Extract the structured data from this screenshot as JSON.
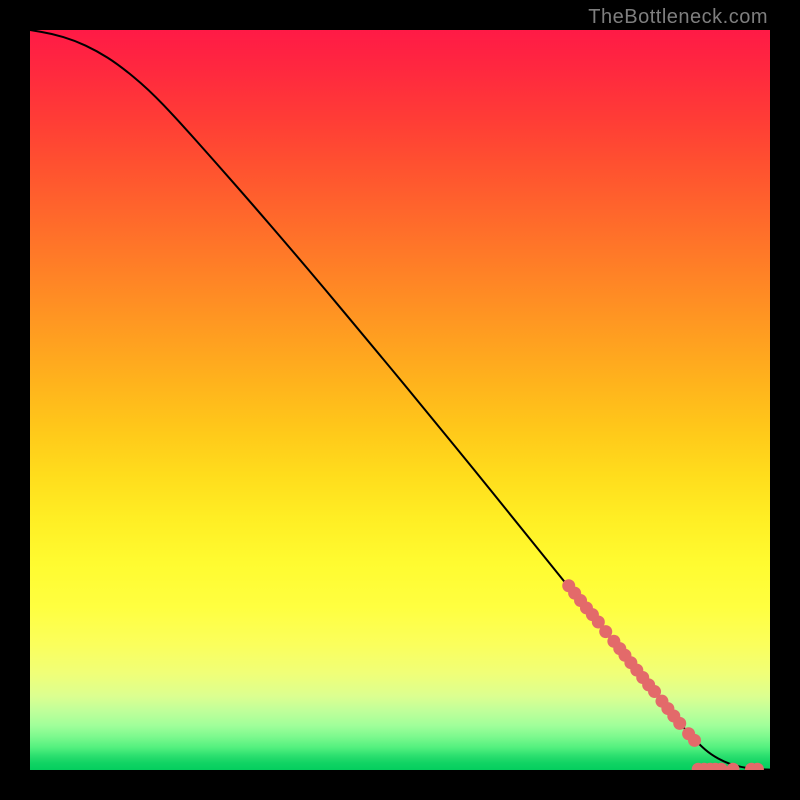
{
  "attribution": "TheBottleneck.com",
  "chart_data": {
    "type": "line",
    "title": "",
    "xlabel": "",
    "ylabel": "",
    "xlim": [
      0,
      100
    ],
    "ylim": [
      0,
      100
    ],
    "series": [
      {
        "name": "main-curve",
        "x": [
          0,
          3,
          6,
          9,
          12,
          16,
          20,
          25,
          30,
          35,
          40,
          45,
          50,
          55,
          60,
          65,
          70,
          75,
          78,
          81,
          84,
          86.5,
          88.5,
          90.5,
          92,
          94,
          96,
          98,
          100
        ],
        "y": [
          100,
          99.5,
          98.6,
          97.2,
          95.3,
          92.0,
          87.8,
          82.2,
          76.5,
          70.7,
          64.8,
          58.8,
          52.8,
          46.7,
          40.6,
          34.4,
          28.2,
          22.0,
          18.3,
          14.6,
          10.9,
          7.9,
          5.5,
          3.4,
          2.1,
          1.0,
          0.4,
          0.12,
          0.05
        ]
      }
    ],
    "markers": [
      {
        "name": "marker",
        "x": 72.8,
        "y": 24.9
      },
      {
        "name": "marker",
        "x": 73.6,
        "y": 23.9
      },
      {
        "name": "marker",
        "x": 74.4,
        "y": 22.9
      },
      {
        "name": "marker",
        "x": 75.2,
        "y": 21.9
      },
      {
        "name": "marker",
        "x": 76.0,
        "y": 21.0
      },
      {
        "name": "marker",
        "x": 76.8,
        "y": 20.0
      },
      {
        "name": "marker",
        "x": 77.8,
        "y": 18.7
      },
      {
        "name": "marker",
        "x": 78.9,
        "y": 17.4
      },
      {
        "name": "marker",
        "x": 79.7,
        "y": 16.4
      },
      {
        "name": "marker",
        "x": 80.4,
        "y": 15.5
      },
      {
        "name": "marker",
        "x": 81.2,
        "y": 14.5
      },
      {
        "name": "marker",
        "x": 82.0,
        "y": 13.5
      },
      {
        "name": "marker",
        "x": 82.8,
        "y": 12.5
      },
      {
        "name": "marker",
        "x": 83.6,
        "y": 11.5
      },
      {
        "name": "marker",
        "x": 84.4,
        "y": 10.6
      },
      {
        "name": "marker",
        "x": 85.4,
        "y": 9.3
      },
      {
        "name": "marker",
        "x": 86.2,
        "y": 8.3
      },
      {
        "name": "marker",
        "x": 87.0,
        "y": 7.3
      },
      {
        "name": "marker",
        "x": 87.8,
        "y": 6.3
      },
      {
        "name": "marker",
        "x": 89.0,
        "y": 4.9
      },
      {
        "name": "marker",
        "x": 89.8,
        "y": 4.0
      },
      {
        "name": "marker",
        "x": 90.3,
        "y": 0.1
      },
      {
        "name": "marker",
        "x": 91.1,
        "y": 0.1
      },
      {
        "name": "marker",
        "x": 91.9,
        "y": 0.1
      },
      {
        "name": "marker",
        "x": 92.6,
        "y": 0.1
      },
      {
        "name": "marker",
        "x": 93.4,
        "y": 0.1
      },
      {
        "name": "marker",
        "x": 95.0,
        "y": 0.1
      },
      {
        "name": "marker",
        "x": 97.5,
        "y": 0.1
      },
      {
        "name": "marker",
        "x": 98.3,
        "y": 0.1
      }
    ],
    "colors": {
      "curve": "#000000",
      "marker_fill": "#e36a6a",
      "marker_stroke": "#934242"
    }
  }
}
